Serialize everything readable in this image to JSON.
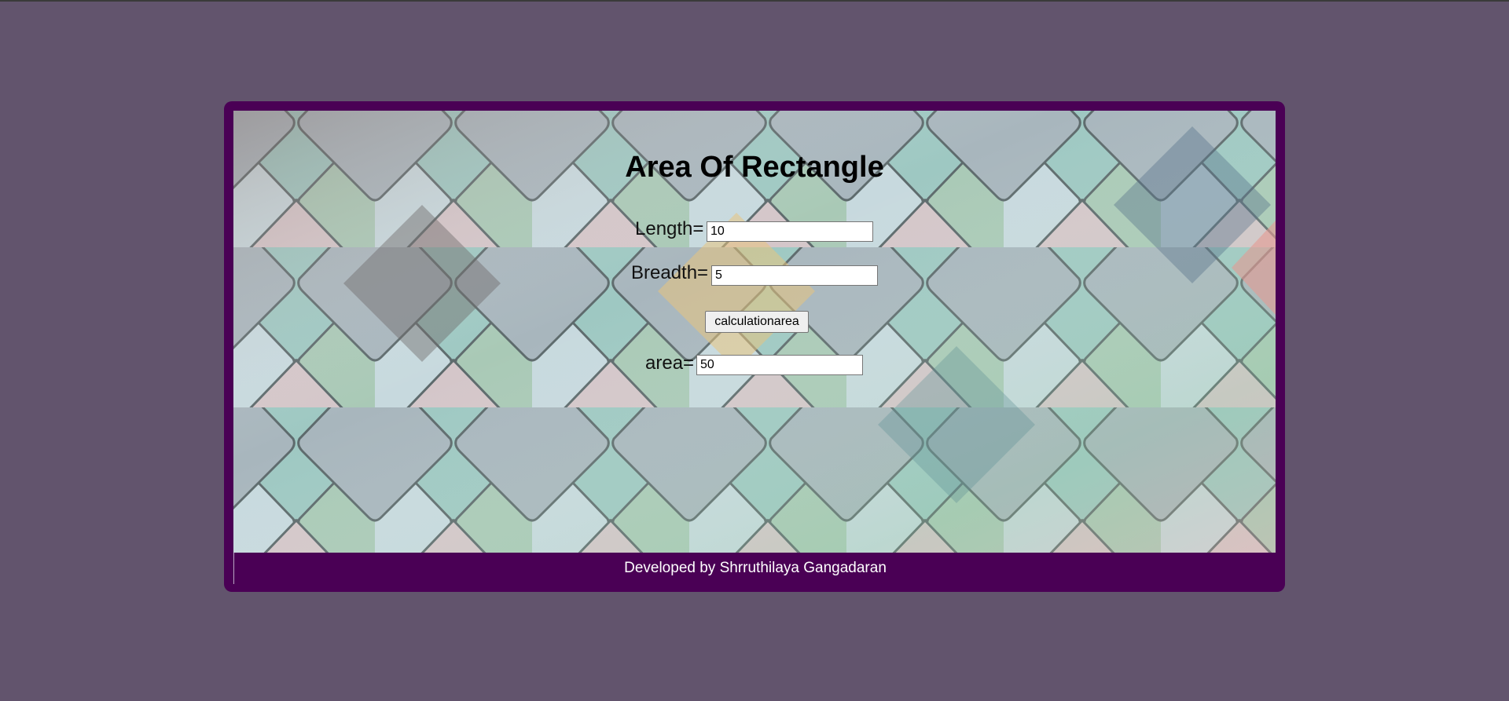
{
  "page": {
    "title": "Area Of Rectangle"
  },
  "form": {
    "length_label": "Length=",
    "length_value": "10",
    "breadth_label": "Breadth=",
    "breadth_value": "5",
    "button_label": "calculationarea",
    "area_label": "area=",
    "area_value": "50"
  },
  "footer": {
    "text": "Developed by Shrruthilaya Gangadaran"
  },
  "colors": {
    "page_background": "#62546d",
    "card_border": "#4a0055",
    "footer_text": "#ffffff"
  },
  "background_image": {
    "subject": "pastel scalloped roof tiles"
  }
}
